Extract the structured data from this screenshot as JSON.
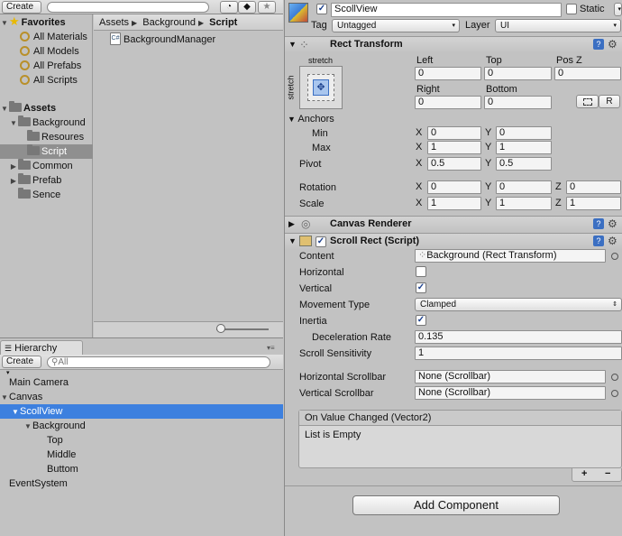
{
  "project": {
    "toolbar": {
      "create_label": "Create",
      "search_placeholder": ""
    },
    "favorites": {
      "title": "Favorites",
      "items": [
        "All Materials",
        "All Models",
        "All Prefabs",
        "All Scripts"
      ]
    },
    "assets": {
      "title": "Assets",
      "items": [
        "Background",
        "Resoures",
        "Script",
        "Common",
        "Prefab",
        "Sence"
      ]
    },
    "breadcrumb": [
      "Assets",
      "Background",
      "Script"
    ],
    "files": [
      "BackgroundManager"
    ]
  },
  "hierarchy": {
    "tab_label": "Hierarchy",
    "create_label": "Create",
    "search_placeholder": "All",
    "items": [
      "Main Camera",
      "Canvas",
      "ScollView",
      "Background",
      "Top",
      "Middle",
      "Buttom",
      "EventSystem"
    ]
  },
  "inspector": {
    "object_name": "ScollView",
    "static_label": "Static",
    "tag_label": "Tag",
    "tag_value": "Untagged",
    "layer_label": "Layer",
    "layer_value": "UI",
    "rect_transform": {
      "title": "Rect Transform",
      "stretch_top": "stretch",
      "stretch_side": "stretch",
      "left_label": "Left",
      "top_label": "Top",
      "posz_label": "Pos Z",
      "left": "0",
      "top": "0",
      "posz": "0",
      "right_label": "Right",
      "bottom_label": "Bottom",
      "right": "0",
      "bottom": "0",
      "r_button": "R",
      "anchors_label": "Anchors",
      "min_label": "Min",
      "max_label": "Max",
      "min_x": "0",
      "min_y": "0",
      "max_x": "1",
      "max_y": "1",
      "pivot_label": "Pivot",
      "pivot_x": "0.5",
      "pivot_y": "0.5",
      "rotation_label": "Rotation",
      "rot_x": "0",
      "rot_y": "0",
      "rot_z": "0",
      "scale_label": "Scale",
      "scale_x": "1",
      "scale_y": "1",
      "scale_z": "1",
      "x": "X",
      "y": "Y",
      "z": "Z"
    },
    "canvas_renderer": {
      "title": "Canvas Renderer"
    },
    "scroll_rect": {
      "title": "Scroll Rect (Script)",
      "content_label": "Content",
      "content_value": "Background (Rect Transform)",
      "horizontal_label": "Horizontal",
      "horizontal_checked": false,
      "vertical_label": "Vertical",
      "vertical_checked": true,
      "movement_label": "Movement Type",
      "movement_value": "Clamped",
      "inertia_label": "Inertia",
      "inertia_checked": true,
      "deceleration_label": "Deceleration Rate",
      "deceleration_value": "0.135",
      "sensitivity_label": "Scroll Sensitivity",
      "sensitivity_value": "1",
      "h_scrollbar_label": "Horizontal Scrollbar",
      "h_scrollbar_value": "None (Scrollbar)",
      "v_scrollbar_label": "Vertical Scrollbar",
      "v_scrollbar_value": "None (Scrollbar)",
      "event_title": "On Value Changed (Vector2)",
      "event_body": "List is Empty",
      "plus": "+",
      "minus": "−"
    },
    "add_component_label": "Add Component"
  },
  "colors": {
    "selection_blue": "#3d80df",
    "panel_gray": "#c2c2c2",
    "help_blue": "#3b6fc2"
  }
}
